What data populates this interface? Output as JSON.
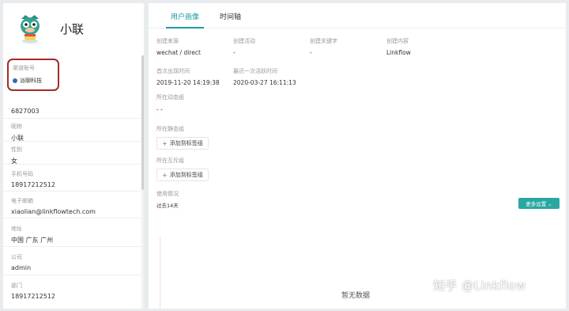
{
  "profile": {
    "name": "小联"
  },
  "source": {
    "label": "渠道账号",
    "tag": "派聊科技",
    "dot_color": "#2f6ab3"
  },
  "left_fields": [
    {
      "label": "",
      "value": "6827003"
    },
    {
      "label": "昵称",
      "value": "小联"
    },
    {
      "label": "性别",
      "value": "女"
    },
    {
      "label": "手机号码",
      "value": "18917212512"
    },
    {
      "label": "电子邮箱",
      "value": "xiaolian@linkflowtech.com"
    },
    {
      "label": "地址",
      "value": "中国 广东 广州"
    },
    {
      "label": "公司",
      "value": "admin"
    },
    {
      "label": "部门",
      "value": "18917212512"
    }
  ],
  "tabs": [
    {
      "label": "用户画像",
      "active": true
    },
    {
      "label": "时间轴",
      "active": false
    }
  ],
  "info": {
    "created_source_label": "创建来源",
    "created_source_value": "wechat / direct",
    "created_activity_label": "创建活动",
    "created_activity_value": "-",
    "created_keyword_label": "创建关键字",
    "created_keyword_value": "-",
    "created_content_label": "创建内容",
    "created_content_value": "Linkflow",
    "first_seen_label": "首次出现时间",
    "first_seen_value": "2019-11-20 14:19:38",
    "last_active_label": "最近一次活跃时间",
    "last_active_value": "2020-03-27 16:11:13"
  },
  "dynamic_group": {
    "label": "所在动态组",
    "value": "- -"
  },
  "static_group": {
    "label": "所在静态组",
    "button": "添加到标签组"
  },
  "mutex_group": {
    "label": "所在互斥组",
    "button": "添加到标签组"
  },
  "usage": {
    "label": "使用情况",
    "period": "过去14天",
    "more_button": "更多设置 ⌄",
    "empty_text": "暂无数据"
  },
  "watermark": "知乎 @Linkflow",
  "colors": {
    "accent": "#1f9aa0",
    "button": "#29a8a3",
    "highlight_box": "#a42a2a"
  }
}
